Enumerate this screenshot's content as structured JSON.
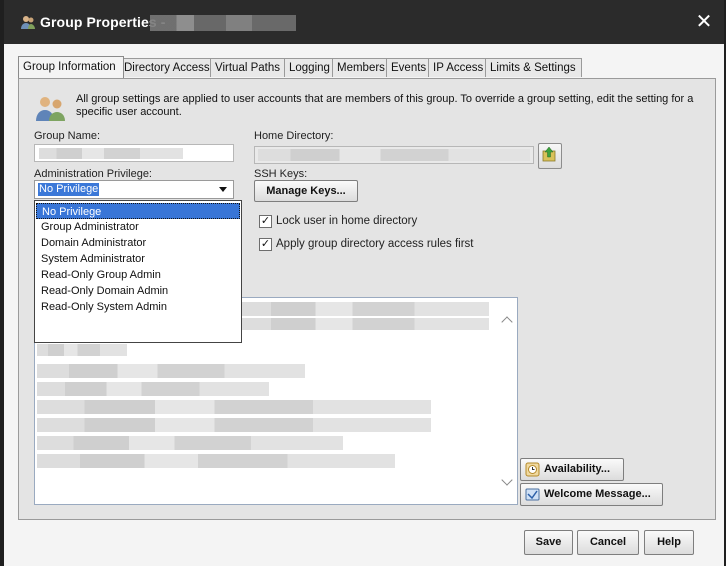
{
  "window": {
    "title": "Group Properties -",
    "close_glyph": "✕",
    "title_icon": "group-users-icon"
  },
  "tabs": [
    {
      "label": "Group Information",
      "active": true
    },
    {
      "label": "Directory Access"
    },
    {
      "label": "Virtual Paths"
    },
    {
      "label": "Logging"
    },
    {
      "label": "Members"
    },
    {
      "label": "Events"
    },
    {
      "label": "IP Access"
    },
    {
      "label": "Limits & Settings"
    }
  ],
  "info": {
    "text": "All group settings are applied to user accounts that are members of this group. To override a group setting, edit the setting for a specific user account."
  },
  "form": {
    "group_name_label": "Group Name:",
    "home_directory_label": "Home Directory:",
    "admin_privilege_label": "Administration Privilege:",
    "admin_privilege_value": "No Privilege",
    "ssh_keys_label": "SSH Keys:",
    "manage_keys_label": "Manage Keys...",
    "lock_user_label": "Lock user in home directory",
    "lock_user_checked": true,
    "apply_rules_label": "Apply group directory access rules first",
    "apply_rules_checked": true
  },
  "dropdown": {
    "options": [
      "No Privilege",
      "Group Administrator",
      "Domain Administrator",
      "System Administrator",
      "Read-Only Group Admin",
      "Read-Only Domain Admin",
      "Read-Only System Admin"
    ],
    "selected_index": 0
  },
  "side_buttons": {
    "availability_label": "Availability...",
    "welcome_label": "Welcome Message..."
  },
  "footer": {
    "save_label": "Save",
    "cancel_label": "Cancel",
    "help_label": "Help"
  },
  "colors": {
    "titlebar": "#2b2b2b",
    "selection": "#3875d7",
    "panel": "#e4e4e4"
  }
}
